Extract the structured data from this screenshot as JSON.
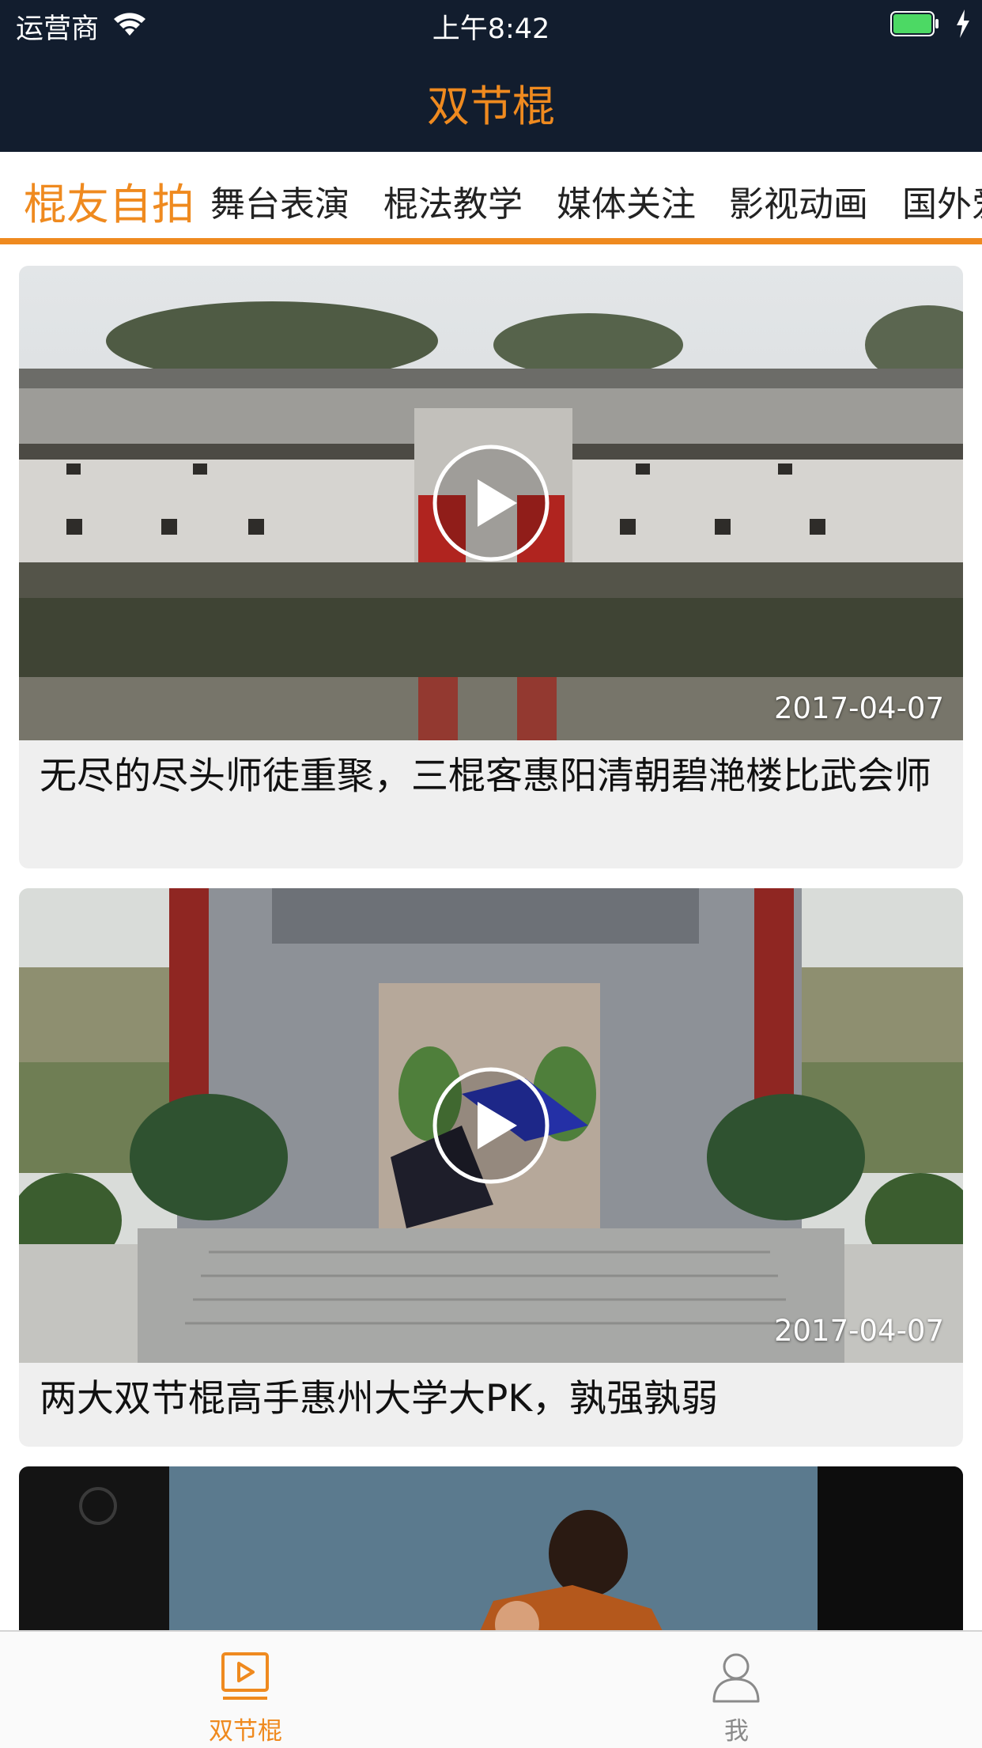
{
  "status_bar": {
    "carrier": "运营商",
    "time": "上午8:42"
  },
  "nav": {
    "title": "双节棍"
  },
  "tabs": [
    {
      "label": "棍友自拍",
      "active": true
    },
    {
      "label": "舞台表演",
      "active": false
    },
    {
      "label": "棍法教学",
      "active": false
    },
    {
      "label": "媒体关注",
      "active": false
    },
    {
      "label": "影视动画",
      "active": false
    },
    {
      "label": "国外爱",
      "active": false
    }
  ],
  "videos": [
    {
      "date": "2017-04-07",
      "title": "无尽的尽头师徒重聚，三棍客惠阳清朝碧滟楼比武会师"
    },
    {
      "date": "2017-04-07",
      "title": "两大双节棍高手惠州大学大PK，孰强孰弱"
    }
  ],
  "tabbar": [
    {
      "label": "双节棍",
      "icon": "video-play-icon",
      "active": true
    },
    {
      "label": "我",
      "icon": "user-icon",
      "active": false
    }
  ],
  "colors": {
    "accent": "#ef8a1f",
    "header_bg": "#121d2e",
    "inactive": "#8a8a8a"
  }
}
